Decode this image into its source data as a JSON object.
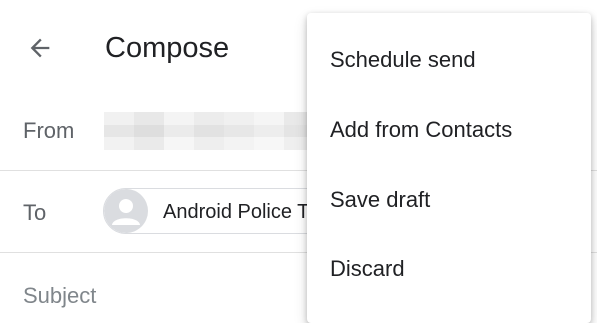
{
  "header": {
    "back_icon": "arrow-back-icon",
    "title": "Compose"
  },
  "fields": {
    "from_label": "From",
    "to_label": "To",
    "subject_placeholder": "Subject"
  },
  "recipient": {
    "name": "Android Police T",
    "avatar_icon": "person-icon"
  },
  "menu": {
    "items": [
      {
        "label": "Schedule send"
      },
      {
        "label": "Add from Contacts"
      },
      {
        "label": "Save draft"
      },
      {
        "label": "Discard"
      }
    ]
  },
  "colors": {
    "text": "#202124",
    "label": "#5f6368",
    "divider": "#e0e0e0",
    "avatar_bg": "#dadce0"
  }
}
